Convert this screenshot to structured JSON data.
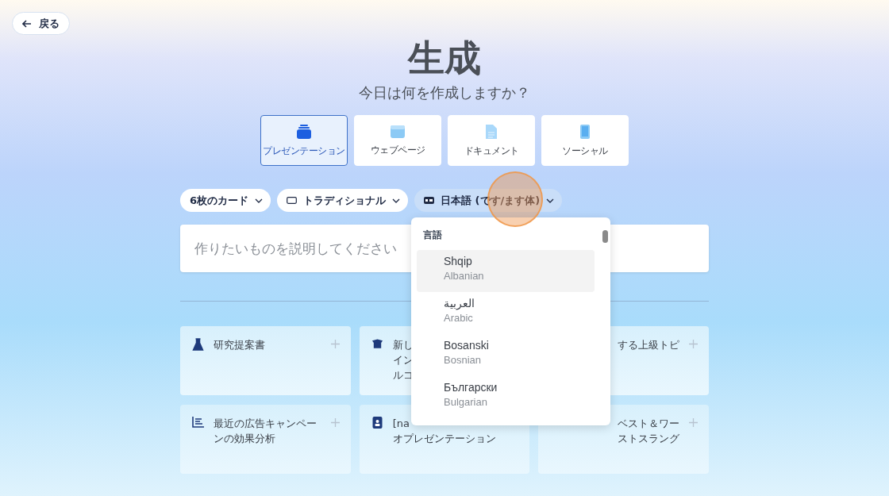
{
  "back_button": {
    "label": "戻る"
  },
  "title": "生成",
  "subtitle": "今日は何を作成しますか？",
  "type_tabs": [
    {
      "label": "プレゼンテーション",
      "selected": true
    },
    {
      "label": "ウェブページ",
      "selected": false
    },
    {
      "label": "ドキュメント",
      "selected": false
    },
    {
      "label": "ソーシャル",
      "selected": false
    }
  ],
  "options": [
    {
      "label": "6枚のカード"
    },
    {
      "label": "トラディショナル"
    },
    {
      "label": "日本語 (です/ます体)"
    }
  ],
  "prompt": {
    "placeholder": "作りたいものを説明してください"
  },
  "language_menu": {
    "heading": "言語",
    "items": [
      {
        "name": "Shqip",
        "english": "Albanian",
        "selected": true
      },
      {
        "name": "العربية",
        "english": "Arabic",
        "selected": false
      },
      {
        "name": "Bosanski",
        "english": "Bosnian",
        "selected": false
      },
      {
        "name": "Български",
        "english": "Bulgarian",
        "selected": false
      }
    ]
  },
  "suggestions": [
    {
      "lines": [
        "研究提案書"
      ]
    },
    {
      "lines": [
        "新し",
        "イン",
        "ルコ"
      ]
    },
    {
      "lines": [
        "する上級トピ"
      ]
    },
    {
      "lines": [
        "最近の広告キャンペー",
        "ンの効果分析"
      ]
    },
    {
      "lines": [
        "[na",
        "オプレゼンテーション"
      ]
    },
    {
      "lines": [
        "ベスト＆ワー",
        "ストスラング"
      ]
    }
  ]
}
